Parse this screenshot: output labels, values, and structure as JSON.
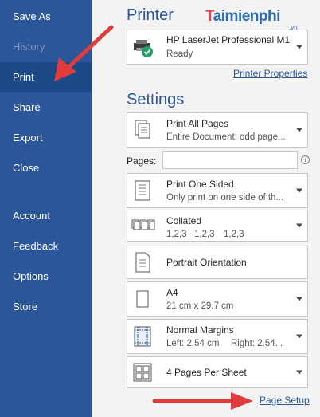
{
  "sidebar": {
    "items": [
      {
        "label": "Save As",
        "state": "normal"
      },
      {
        "label": "History",
        "state": "disabled"
      },
      {
        "label": "Print",
        "state": "active"
      },
      {
        "label": "Share",
        "state": "normal"
      },
      {
        "label": "Export",
        "state": "normal"
      },
      {
        "label": "Close",
        "state": "normal"
      },
      {
        "label": "Account",
        "state": "normal"
      },
      {
        "label": "Feedback",
        "state": "normal"
      },
      {
        "label": "Options",
        "state": "normal"
      },
      {
        "label": "Store",
        "state": "normal"
      }
    ]
  },
  "printer": {
    "title": "Printer",
    "name": "HP LaserJet Professional M1...",
    "status": "Ready",
    "properties_link": "Printer Properties"
  },
  "settings": {
    "title": "Settings",
    "print_range": {
      "main": "Print All Pages",
      "sub": "Entire Document: odd page..."
    },
    "pages": {
      "label": "Pages:",
      "value": ""
    },
    "sides": {
      "main": "Print One Sided",
      "sub": "Only print on one side of th..."
    },
    "collation": {
      "main": "Collated",
      "sub1": "1,2,3",
      "sub2": "1,2,3",
      "sub3": "1,2,3"
    },
    "orientation": {
      "main": "Portrait Orientation"
    },
    "paper": {
      "main": "A4",
      "sub": "21 cm x 29.7 cm"
    },
    "margins": {
      "main": "Normal Margins",
      "sub_left": "Left:  2.54 cm",
      "sub_right": "Right:  2.54..."
    },
    "per_sheet": {
      "main": "4 Pages Per Sheet"
    },
    "page_setup_link": "Page Setup"
  },
  "watermark": {
    "brand_t": "T",
    "brand_rest": "aimienphi",
    "domain": ".vn"
  },
  "colors": {
    "sidebar": "#2b579a",
    "accent": "#2b579a",
    "arrow": "#e03c3c",
    "ready_check": "#21a366"
  }
}
